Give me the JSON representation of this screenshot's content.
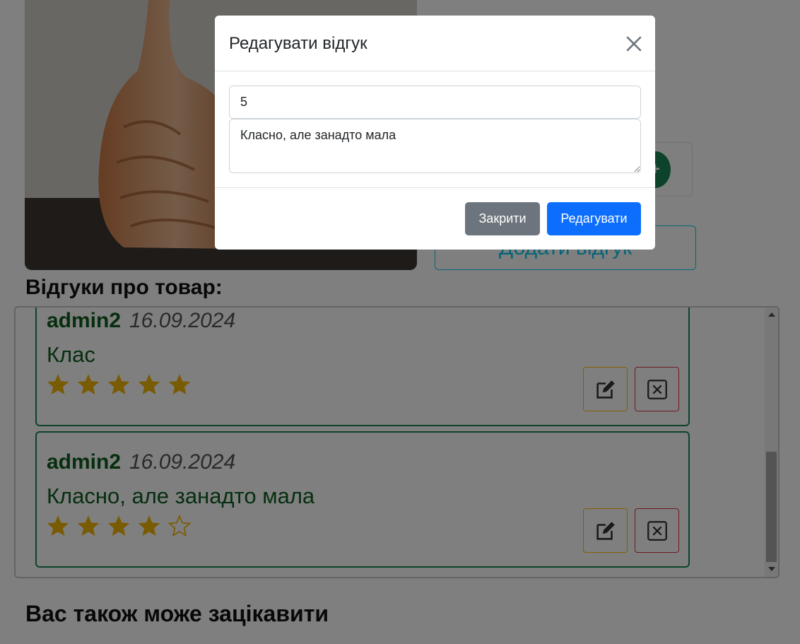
{
  "modal": {
    "title": "Редагувати відгук",
    "rating_value": "5",
    "comment_value": "Класно, але занадто мала",
    "close_label": "Закрити",
    "save_label": "Редагувати"
  },
  "page": {
    "add_review_label": "Додати відгук",
    "reviews_heading": "Відгуки про товар:",
    "also_heading": "Вас також може зацікавити"
  },
  "reviews": [
    {
      "author": "admin2",
      "date": "16.09.2024",
      "text": "Клас",
      "rating": 5
    },
    {
      "author": "admin2",
      "date": "16.09.2024",
      "text": "Класно, але занадто мала",
      "rating": 4
    }
  ],
  "colors": {
    "success": "#198754",
    "star": "#f2b705",
    "primary": "#0d6efd",
    "secondary": "#6c757d",
    "info": "#0dcaf0",
    "warning": "#ffc107",
    "danger": "#dc3545"
  },
  "icons": {
    "edit": "pencil-square-icon",
    "delete": "x-square-icon",
    "close": "close-icon",
    "star": "star-icon"
  }
}
